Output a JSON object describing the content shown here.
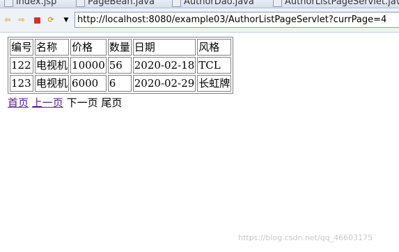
{
  "editor_tabs": [
    "index.jsp",
    "PageBean.java",
    "AuthorDao.java",
    "AuthorListPageServlet.java"
  ],
  "toolbar": {
    "back_icon": "back-arrow-icon",
    "forward_icon": "forward-arrow-icon",
    "stop_icon": "stop-icon",
    "refresh_icon": "refresh-icon",
    "menu_icon": "dropdown-triangle-icon"
  },
  "address_bar": {
    "url": "http://localhost:8080/example03/AuthorListPageServlet?currPage=4"
  },
  "table": {
    "headers": [
      "编号",
      "名称",
      "价格",
      "数量",
      "日期",
      "风格"
    ],
    "rows": [
      [
        "122",
        "电视机",
        "10000",
        "56",
        "2020-02-18",
        "TCL"
      ],
      [
        "123",
        "电视机",
        "6000",
        "6",
        "2020-02-29",
        "长虹牌"
      ]
    ]
  },
  "pager": {
    "first": "首页",
    "prev": "上一页",
    "next": "下一页",
    "last": "尾页"
  },
  "watermark": "https://blog.csdn.net/qq_46603175",
  "colors": {
    "link_visited": "#551a8b",
    "border": "#808080",
    "stop_icon": "#d32f2f"
  }
}
